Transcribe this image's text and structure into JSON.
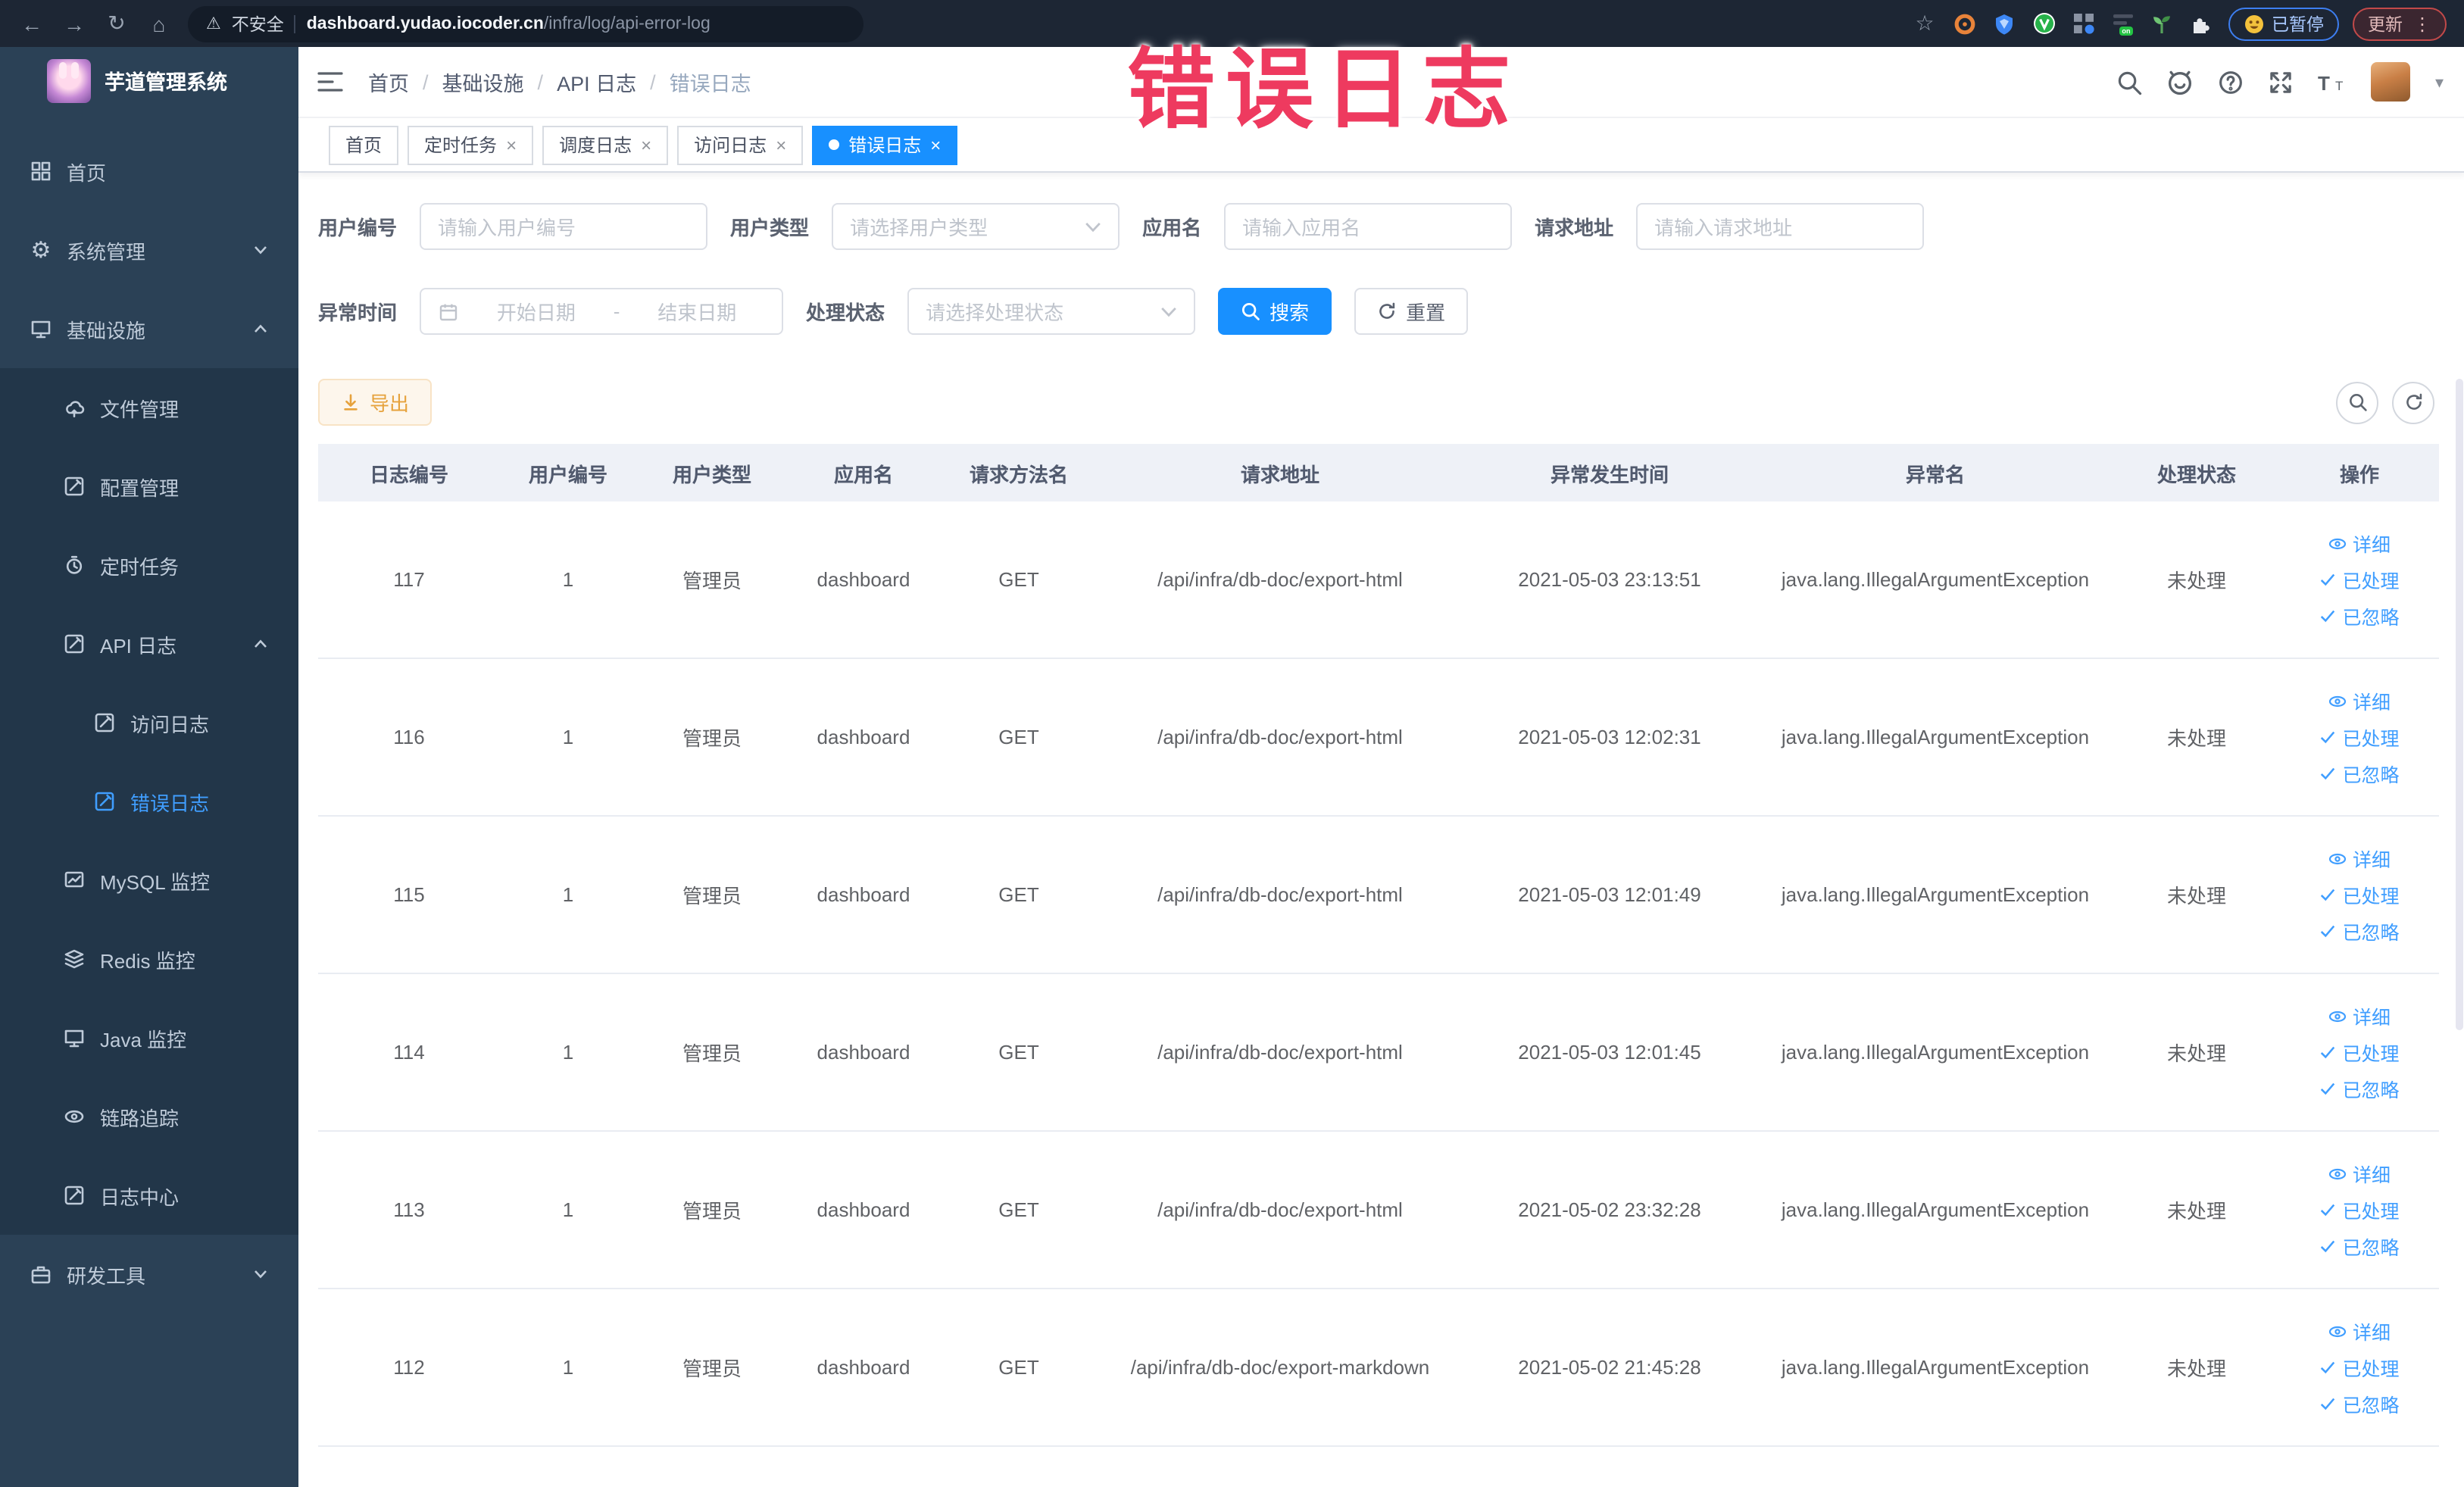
{
  "overlay_title": "错误日志",
  "colors": {
    "accent": "#1890ff",
    "link_blue": "#409eff",
    "sidebar_bg": "#2b4156",
    "submenu_bg": "#223649",
    "export_orange": "#e6a23c",
    "overlay_red": "#ee3a5f"
  },
  "icons": {
    "back": "←",
    "forward": "→",
    "reload": "↻",
    "home": "⌂",
    "warning": "⚠",
    "star": "☆",
    "close": "×",
    "separator": "/",
    "caret_down": "▾",
    "kebab": "⋮",
    "gear": "⚙"
  },
  "browser": {
    "security_label": "不安全",
    "url_domain": "dashboard.yudao.iocoder.cn",
    "url_path": "/infra/log/api-error-log",
    "paused_badge": "已暂停",
    "update_button": "更新"
  },
  "sidebar": {
    "app_title": "芋道管理系统",
    "items": [
      {
        "label": "首页"
      },
      {
        "label": "系统管理"
      },
      {
        "label": "基础设施"
      },
      {
        "label": "文件管理"
      },
      {
        "label": "配置管理"
      },
      {
        "label": "定时任务"
      },
      {
        "label": "API 日志"
      },
      {
        "label": "访问日志"
      },
      {
        "label": "错误日志"
      },
      {
        "label": "MySQL 监控"
      },
      {
        "label": "Redis 监控"
      },
      {
        "label": "Java 监控"
      },
      {
        "label": "链路追踪"
      },
      {
        "label": "日志中心"
      },
      {
        "label": "研发工具"
      }
    ]
  },
  "breadcrumb": [
    "首页",
    "基础设施",
    "API 日志",
    "错误日志"
  ],
  "tabs": [
    {
      "label": "首页"
    },
    {
      "label": "定时任务"
    },
    {
      "label": "调度日志"
    },
    {
      "label": "访问日志"
    },
    {
      "label": "错误日志"
    }
  ],
  "filters": {
    "user_id_label": "用户编号",
    "user_id_placeholder": "请输入用户编号",
    "user_type_label": "用户类型",
    "user_type_placeholder": "请选择用户类型",
    "app_name_label": "应用名",
    "app_name_placeholder": "请输入应用名",
    "request_url_label": "请求地址",
    "request_url_placeholder": "请输入请求地址",
    "exception_time_label": "异常时间",
    "date_start_placeholder": "开始日期",
    "date_separator": "-",
    "date_end_placeholder": "结束日期",
    "process_status_label": "处理状态",
    "process_status_placeholder": "请选择处理状态",
    "search_label": "搜索",
    "reset_label": "重置"
  },
  "toolbar": {
    "export_label": "导出"
  },
  "table": {
    "columns": [
      "日志编号",
      "用户编号",
      "用户类型",
      "应用名",
      "请求方法名",
      "请求地址",
      "异常发生时间",
      "异常名",
      "处理状态",
      "操作"
    ],
    "actions": [
      "详细",
      "已处理",
      "已忽略"
    ],
    "rows": [
      {
        "id": "117",
        "user_id": "1",
        "user_type": "管理员",
        "app": "dashboard",
        "method": "GET",
        "url": "/api/infra/db-doc/export-html",
        "time": "2021-05-03 23:13:51",
        "exception": "java.lang.IllegalArgumentException",
        "status": "未处理"
      },
      {
        "id": "116",
        "user_id": "1",
        "user_type": "管理员",
        "app": "dashboard",
        "method": "GET",
        "url": "/api/infra/db-doc/export-html",
        "time": "2021-05-03 12:02:31",
        "exception": "java.lang.IllegalArgumentException",
        "status": "未处理"
      },
      {
        "id": "115",
        "user_id": "1",
        "user_type": "管理员",
        "app": "dashboard",
        "method": "GET",
        "url": "/api/infra/db-doc/export-html",
        "time": "2021-05-03 12:01:49",
        "exception": "java.lang.IllegalArgumentException",
        "status": "未处理"
      },
      {
        "id": "114",
        "user_id": "1",
        "user_type": "管理员",
        "app": "dashboard",
        "method": "GET",
        "url": "/api/infra/db-doc/export-html",
        "time": "2021-05-03 12:01:45",
        "exception": "java.lang.IllegalArgumentException",
        "status": "未处理"
      },
      {
        "id": "113",
        "user_id": "1",
        "user_type": "管理员",
        "app": "dashboard",
        "method": "GET",
        "url": "/api/infra/db-doc/export-html",
        "time": "2021-05-02 23:32:28",
        "exception": "java.lang.IllegalArgumentException",
        "status": "未处理"
      },
      {
        "id": "112",
        "user_id": "1",
        "user_type": "管理员",
        "app": "dashboard",
        "method": "GET",
        "url": "/api/infra/db-doc/export-markdown",
        "time": "2021-05-02 21:45:28",
        "exception": "java.lang.IllegalArgumentException",
        "status": "未处理"
      }
    ]
  }
}
